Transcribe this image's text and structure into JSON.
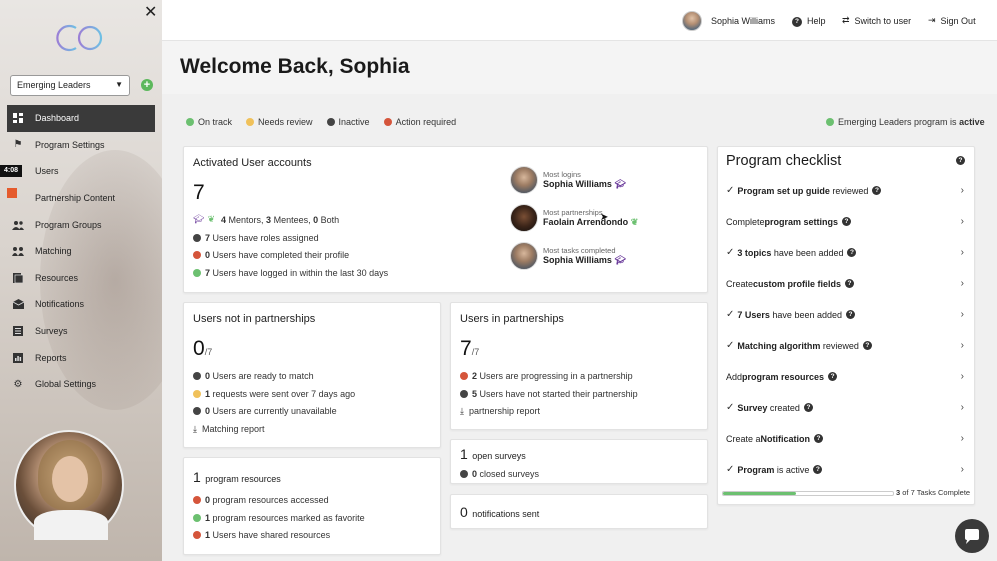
{
  "sidebar": {
    "program_select": "Emerging Leaders",
    "time_badge": "4:08",
    "items": [
      {
        "label": "Dashboard",
        "icon": "dashboard-icon",
        "active": true
      },
      {
        "label": "Program Settings",
        "icon": "settings-flag-icon"
      },
      {
        "label": "Users",
        "icon": "users-icon"
      },
      {
        "label": "Partnership Content",
        "icon": "content-icon"
      },
      {
        "label": "Program Groups",
        "icon": "groups-icon"
      },
      {
        "label": "Matching",
        "icon": "matching-icon"
      },
      {
        "label": "Resources",
        "icon": "resources-icon"
      },
      {
        "label": "Notifications",
        "icon": "notifications-icon"
      },
      {
        "label": "Surveys",
        "icon": "surveys-icon"
      },
      {
        "label": "Reports",
        "icon": "reports-icon"
      },
      {
        "label": "Global Settings",
        "icon": "gear-icon"
      }
    ]
  },
  "topbar": {
    "user_name": "Sophia Williams",
    "help": "Help",
    "switch_user": "Switch to user",
    "sign_out": "Sign Out"
  },
  "welcome": "Welcome Back, Sophia",
  "legend": {
    "on_track": "On track",
    "needs_review": "Needs review",
    "inactive": "Inactive",
    "action_required": "Action required"
  },
  "program_status": {
    "prefix": "Emerging Leaders program is",
    "status": "active"
  },
  "activated": {
    "title": "Activated User accounts",
    "count": "7",
    "mentors": "4",
    "mentors_label": "Mentors,",
    "mentees": "3",
    "mentees_label": "Mentees,",
    "both": "0",
    "both_label": "Both",
    "roles": "7",
    "roles_label": "Users have roles assigned",
    "profile": "0",
    "profile_label": "Users have completed their profile",
    "logged": "7",
    "logged_label": "Users have logged in within the last 30 days",
    "most_logins_label": "Most logins",
    "most_logins_name": "Sophia Williams",
    "most_partnerships_label": "Most partnerships",
    "most_partnerships_name": "Faolain Arrendondo",
    "most_tasks_label": "Most tasks completed",
    "most_tasks_name": "Sophia Williams"
  },
  "not_in": {
    "title": "Users not in partnerships",
    "count": "0",
    "total": "/7",
    "ready": "0",
    "ready_label": "Users are ready to match",
    "requests": "1",
    "requests_label": "requests were sent over 7 days ago",
    "unavailable": "0",
    "unavailable_label": "Users are currently unavailable",
    "report": "Matching report"
  },
  "in": {
    "title": "Users in partnerships",
    "count": "7",
    "total": "/7",
    "progressing": "2",
    "progressing_label": "Users are progressing in a partnership",
    "not_started": "5",
    "not_started_label": "Users have not started their partnership",
    "report": "partnership report"
  },
  "resources": {
    "count": "1",
    "count_label": "program resources",
    "accessed": "0",
    "accessed_label": "program resources accessed",
    "favorite": "1",
    "favorite_label": "program resources marked as favorite",
    "shared": "1",
    "shared_label": "Users have shared resources"
  },
  "surveys": {
    "open": "1",
    "open_label": "open surveys",
    "closed": "0",
    "closed_label": "closed surveys"
  },
  "notifications": {
    "count": "0",
    "label": "notifications sent"
  },
  "checklist": {
    "title": "Program checklist",
    "items": [
      {
        "done": true,
        "pre": "",
        "bold": "Program set up guide",
        "post": " reviewed"
      },
      {
        "done": false,
        "pre": "Complete ",
        "bold": "program settings",
        "post": ""
      },
      {
        "done": true,
        "pre": "",
        "bold": "3 topics",
        "post": " have been added"
      },
      {
        "done": false,
        "pre": "Create ",
        "bold": "custom profile fields",
        "post": ""
      },
      {
        "done": true,
        "pre": "",
        "bold": "7 Users",
        "post": " have been added"
      },
      {
        "done": true,
        "pre": "",
        "bold": "Matching algorithm",
        "post": " reviewed"
      },
      {
        "done": false,
        "pre": "Add ",
        "bold": "program resources",
        "post": ""
      },
      {
        "done": true,
        "pre": "",
        "bold": "Survey",
        "post": " created"
      },
      {
        "done": false,
        "pre": "Create a ",
        "bold": "Notification",
        "post": ""
      },
      {
        "done": true,
        "pre": "",
        "bold": "Program",
        "post": " is active"
      }
    ],
    "progress_done": "3",
    "progress_of": "of 7 Tasks Complete",
    "progress_fraction": 0.4286
  },
  "colors": {
    "green": "#6cc070",
    "yellow": "#f0c15a",
    "dark": "#444444",
    "red": "#d5553b",
    "sidebar_active": "#3a3a3a"
  }
}
